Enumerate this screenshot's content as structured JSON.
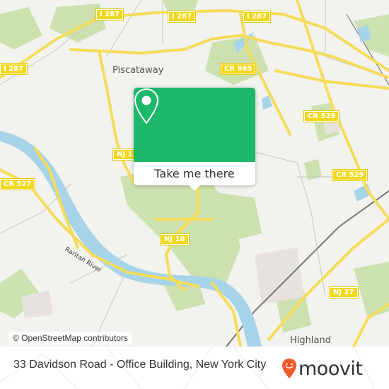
{
  "map": {
    "road_shields": [
      {
        "label": "I 287",
        "id": "i287-a"
      },
      {
        "label": "I 287",
        "id": "i287-b"
      },
      {
        "label": "I 287",
        "id": "i287-c"
      },
      {
        "label": "I 287",
        "id": "i287-d"
      },
      {
        "label": "CR 665",
        "id": "cr665"
      },
      {
        "label": "CR 529",
        "id": "cr529-a"
      },
      {
        "label": "CR 529",
        "id": "cr529-b"
      },
      {
        "label": "CR 527",
        "id": "cr527"
      },
      {
        "label": "NJ 1",
        "id": "nj1"
      },
      {
        "label": "NJ 18",
        "id": "nj18"
      },
      {
        "label": "NJ 27",
        "id": "nj27"
      }
    ],
    "places": {
      "piscataway": "Piscataway",
      "highland": "Highland"
    },
    "river_label": "Raritan River",
    "attribution": "© OpenStreetMap contributors",
    "colors": {
      "background": "#f2f2ee",
      "park": "#c8e0a8",
      "water": "#a8d4ea",
      "road": "#f5dc5a",
      "popup": "#1db86a"
    }
  },
  "popup": {
    "icon": "map-pin-icon",
    "button_label": "Take me there"
  },
  "footer": {
    "title": "33 Davidson Road - Office Building, New York City",
    "logo_text": "moovit",
    "logo_icon": "moovit-smiley-pin-icon",
    "logo_color": "#f05a28"
  }
}
